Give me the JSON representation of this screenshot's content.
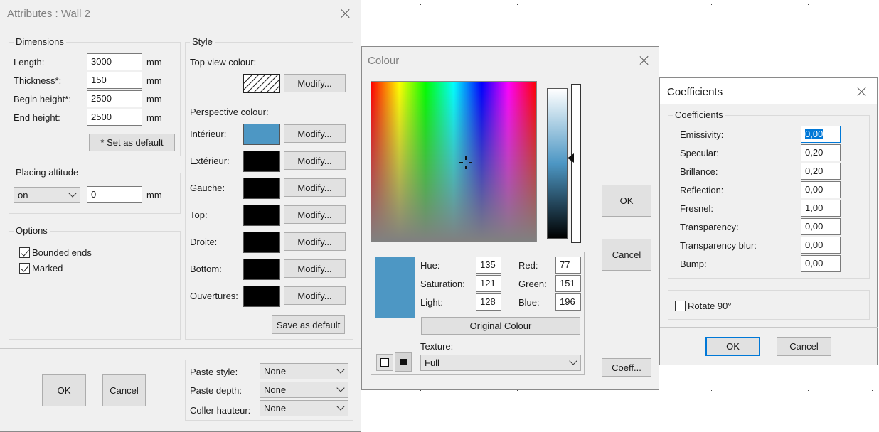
{
  "attributes_dialog": {
    "title": "Attributes : Wall 2",
    "dimensions": {
      "legend": "Dimensions",
      "length_label": "Length:",
      "length_value": "3000",
      "thickness_label": "Thickness*:",
      "thickness_value": "150",
      "begin_height_label": "Begin height*:",
      "begin_height_value": "2500",
      "end_height_label": "End height:",
      "end_height_value": "2500",
      "unit": "mm",
      "set_default_label": "* Set as default"
    },
    "placing": {
      "legend": "Placing altitude",
      "mode_value": "on",
      "altitude_value": "0",
      "unit": "mm"
    },
    "options": {
      "legend": "Options",
      "bounded_ends_label": "Bounded ends",
      "bounded_ends_checked": true,
      "marked_label": "Marked",
      "marked_checked": true
    },
    "style": {
      "legend": "Style",
      "top_view_label": "Top view colour:",
      "perspective_label": "Perspective colour:",
      "modify_label": "Modify...",
      "rows": [
        {
          "label": "Intérieur:",
          "color": "#4d97c4"
        },
        {
          "label": "Extérieur:",
          "color": "#000000"
        },
        {
          "label": "Gauche:",
          "color": "#000000"
        },
        {
          "label": "Top:",
          "color": "#000000"
        },
        {
          "label": "Droite:",
          "color": "#000000"
        },
        {
          "label": "Bottom:",
          "color": "#000000"
        },
        {
          "label": "Ouvertures:",
          "color": "#000000"
        }
      ],
      "save_default_label": "Save as default"
    },
    "ok_label": "OK",
    "cancel_label": "Cancel",
    "paste": {
      "style_label": "Paste style:",
      "style_value": "None",
      "depth_label": "Paste depth:",
      "depth_value": "None",
      "height_label": "Coller hauteur:",
      "height_value": "None"
    }
  },
  "colour_dialog": {
    "title": "Colour",
    "preview_color": "#4d97c4",
    "hue_label": "Hue:",
    "hue_value": "135",
    "saturation_label": "Saturation:",
    "saturation_value": "121",
    "light_label": "Light:",
    "light_value": "128",
    "red_label": "Red:",
    "red_value": "77",
    "green_label": "Green:",
    "green_value": "151",
    "blue_label": "Blue:",
    "blue_value": "196",
    "original_colour_label": "Original Colour",
    "texture_label": "Texture:",
    "texture_value": "Full",
    "ok_label": "OK",
    "cancel_label": "Cancel",
    "coeff_label": "Coeff..."
  },
  "coefficients_dialog": {
    "title": "Coefficients",
    "legend": "Coefficients",
    "rows": [
      {
        "label": "Emissivity:",
        "value": "0,00"
      },
      {
        "label": "Specular:",
        "value": "0,20"
      },
      {
        "label": "Brillance:",
        "value": "0,20"
      },
      {
        "label": "Reflection:",
        "value": "0,00"
      },
      {
        "label": "Fresnel:",
        "value": "1,00"
      },
      {
        "label": "Transparency:",
        "value": "0,00"
      },
      {
        "label": "Transparency blur:",
        "value": "0,00"
      },
      {
        "label": "Bump:",
        "value": "0,00"
      }
    ],
    "rotate_label": "Rotate 90°",
    "rotate_checked": false,
    "ok_label": "OK",
    "cancel_label": "Cancel"
  }
}
